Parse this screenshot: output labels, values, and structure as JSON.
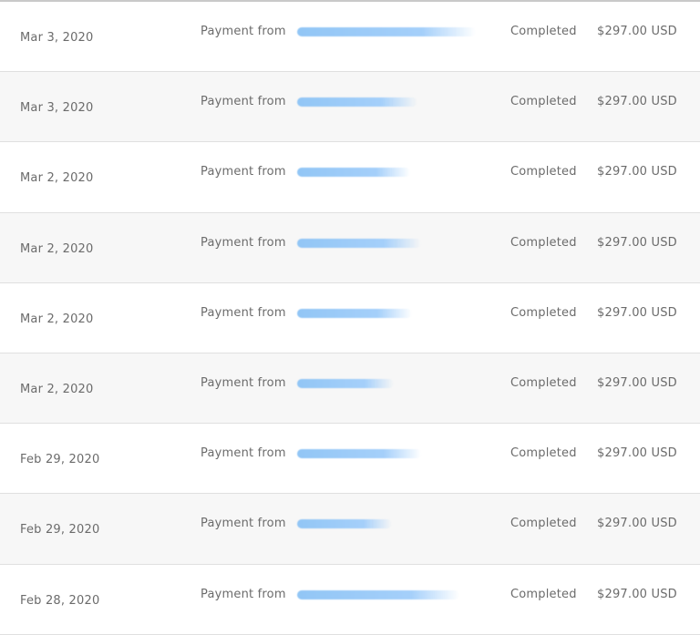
{
  "transactions": [
    {
      "date": "Mar 3, 2020",
      "description": "Payment from",
      "status": "Completed",
      "amount": "$297.00 USD"
    },
    {
      "date": "Mar 3, 2020",
      "description": "Payment from",
      "status": "Completed",
      "amount": "$297.00 USD"
    },
    {
      "date": "Mar 2, 2020",
      "description": "Payment from",
      "status": "Completed",
      "amount": "$297.00 USD"
    },
    {
      "date": "Mar 2, 2020",
      "description": "Payment from",
      "status": "Completed",
      "amount": "$297.00 USD"
    },
    {
      "date": "Mar 2, 2020",
      "description": "Payment from",
      "status": "Completed",
      "amount": "$297.00 USD"
    },
    {
      "date": "Mar 2, 2020",
      "description": "Payment from",
      "status": "Completed",
      "amount": "$297.00 USD"
    },
    {
      "date": "Feb 29, 2020",
      "description": "Payment from",
      "status": "Completed",
      "amount": "$297.00 USD"
    },
    {
      "date": "Feb 29, 2020",
      "description": "Payment from",
      "status": "Completed",
      "amount": "$297.00 USD"
    },
    {
      "date": "Feb 28, 2020",
      "description": "Payment from",
      "status": "Completed",
      "amount": "$297.00 USD"
    }
  ]
}
